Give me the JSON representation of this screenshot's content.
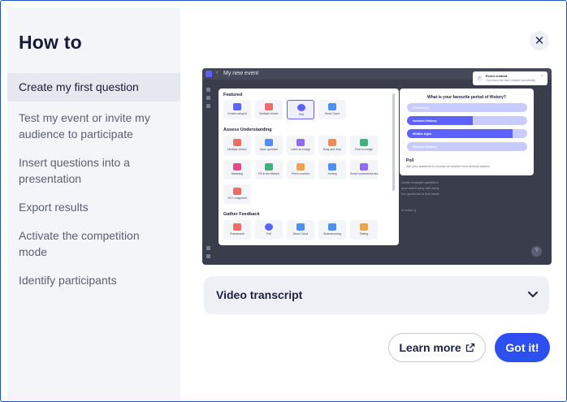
{
  "sidebar": {
    "title": "How to",
    "items": [
      {
        "label": "Create my first question",
        "active": true
      },
      {
        "label": "Test my event or invite my audience to participate"
      },
      {
        "label": "Insert questions into a presentation"
      },
      {
        "label": "Export results"
      },
      {
        "label": "Activate the competition mode"
      },
      {
        "label": "Identify participants"
      }
    ]
  },
  "close": {
    "icon": "close-icon",
    "glyph": "✕"
  },
  "preview": {
    "topbar_title": "My new event",
    "back_glyph": "‹",
    "toast": {
      "title": "Event created",
      "subtitle": "Your event has been created successfully.",
      "close": "×",
      "check": "✓"
    },
    "menu": {
      "sections": [
        {
          "title": "Featured",
          "tiles": [
            {
              "label": "Create using AI",
              "icon": "ai-pen-icon",
              "color": "#5d62ff"
            },
            {
              "label": "Multiple choice",
              "icon": "multiple-choice-icon",
              "color": "#ef6a6a"
            },
            {
              "label": "Poll",
              "icon": "poll-icon",
              "color": "#5d62ff",
              "selected": true
            },
            {
              "label": "Word Cloud",
              "icon": "word-cloud-icon",
              "color": "#4b8ff7"
            }
          ]
        },
        {
          "title": "Assess Understanding",
          "tiles": [
            {
              "label": "Multiple choice",
              "icon": "multiple-choice-icon",
              "color": "#ef6a6a"
            },
            {
              "label": "Open question",
              "icon": "open-question-icon",
              "color": "#4b8ff7"
            },
            {
              "label": "Label an image",
              "icon": "label-image-icon",
              "color": "#8f6bf2"
            },
            {
              "label": "Drag and drop",
              "icon": "drag-drop-icon",
              "color": "#f08a5d"
            },
            {
              "label": "Find on image",
              "icon": "find-image-icon",
              "color": "#3fb27f"
            },
            {
              "label": "Matching",
              "icon": "matching-icon",
              "color": "#e24a8a"
            },
            {
              "label": "Fill in the Blanks",
              "icon": "fill-blanks-icon",
              "color": "#3fb27f"
            },
            {
              "label": "Find a number",
              "icon": "find-number-icon",
              "color": "#f0a34a"
            },
            {
              "label": "Sorting",
              "icon": "sorting-icon",
              "color": "#4b8ff7"
            },
            {
              "label": "Script connections test",
              "icon": "script-test-icon",
              "color": "#8f6bf2"
            },
            {
              "label": "SCT Judgment",
              "icon": "sct-icon",
              "color": "#ef6a6a"
            }
          ]
        },
        {
          "title": "Gather Feedback",
          "tiles": [
            {
              "label": "Framework",
              "icon": "framework-icon",
              "color": "#ef6a6a"
            },
            {
              "label": "Poll",
              "icon": "poll-icon",
              "color": "#5d62ff"
            },
            {
              "label": "Word Cloud",
              "icon": "word-cloud-icon",
              "color": "#4b8ff7"
            },
            {
              "label": "Brainstorming",
              "icon": "brainstorming-icon",
              "color": "#4b8ff7"
            },
            {
              "label": "Rating",
              "icon": "rating-icon",
              "color": "#f0a34a"
            }
          ]
        }
      ]
    },
    "poll": {
      "question": "What is your favourite period of History?",
      "options": [
        {
          "label": "Prehistory",
          "fill": 0
        },
        {
          "label": "Ancient History",
          "fill": 0.55
        },
        {
          "label": "Middle Ages",
          "fill": 0.88
        },
        {
          "label": "Modern History",
          "fill": 0
        }
      ],
      "type_title": "Poll",
      "type_desc": "Ask your audience to choose an answer from several options."
    },
    "bg_texts": [
      "create example questions",
      "your event early with early",
      "the questions in test mode",
      "ur event ()"
    ],
    "help_glyph": "?"
  },
  "transcript": {
    "label": "Video transcript",
    "icon": "chevron-down-icon"
  },
  "buttons": {
    "learn_more": "Learn more",
    "learn_more_icon": "external-link-icon",
    "got_it": "Got it!"
  },
  "colors": {
    "accent": "#2e4ff0",
    "brand_purple": "#5d62ff",
    "sidebar_bg": "#f4f5f8"
  }
}
